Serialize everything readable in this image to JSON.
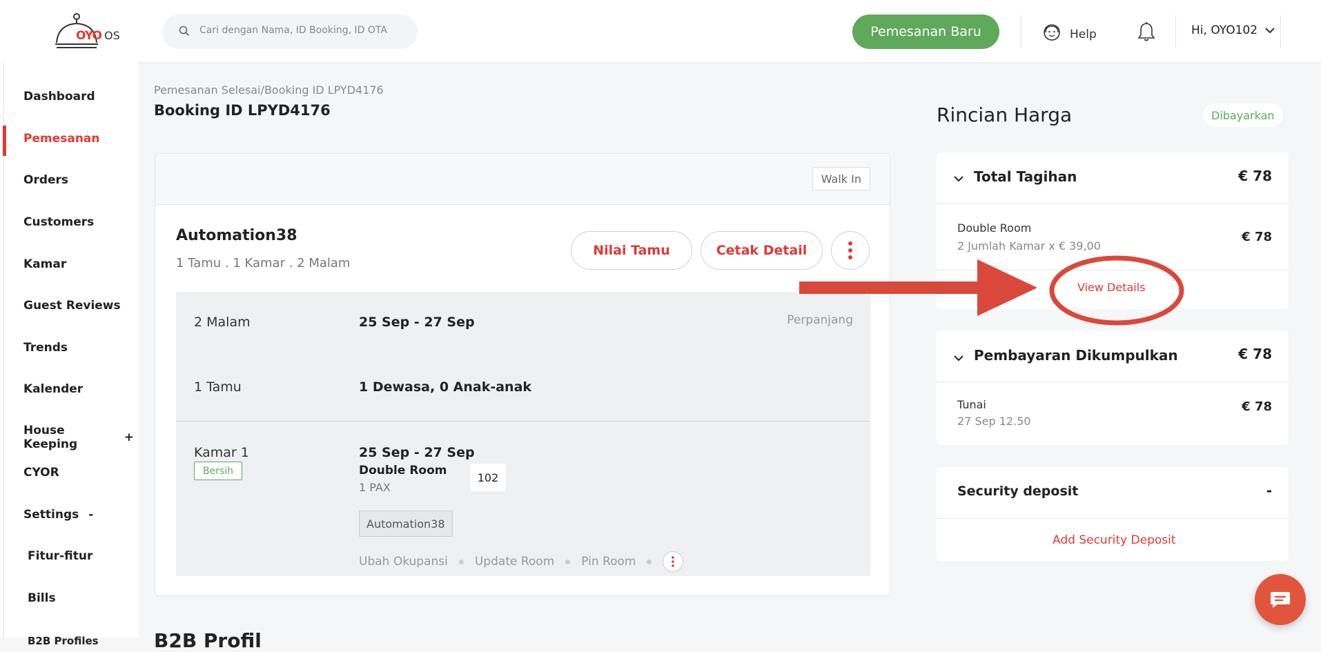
{
  "brand": {
    "logo_text": "OYO",
    "logo_suffix": "OS"
  },
  "search": {
    "placeholder": "Cari dengan Nama, ID Booking, ID OTA"
  },
  "header": {
    "new_booking": "Pemesanan Baru",
    "help": "Help",
    "user": "Hi, OYO102"
  },
  "sidebar": {
    "items": [
      {
        "label": "Dashboard"
      },
      {
        "label": "Pemesanan",
        "active": true
      },
      {
        "label": "Orders"
      },
      {
        "label": "Customers"
      },
      {
        "label": "Kamar"
      },
      {
        "label": "Guest Reviews"
      },
      {
        "label": "Trends"
      },
      {
        "label": "Kalender"
      },
      {
        "label": "House Keeping",
        "suffix": "+"
      },
      {
        "label": "CYOR"
      },
      {
        "label": "Settings",
        "suffix": "-"
      },
      {
        "label": "Fitur-fitur"
      },
      {
        "label": "Bills"
      },
      {
        "label": "B2B Profiles"
      }
    ]
  },
  "breadcrumb": {
    "parent": "Pemesanan Selesai",
    "separator": "/",
    "current": "Booking ID LPYD4176"
  },
  "page_title": "Booking ID LPYD4176",
  "booking": {
    "source_badge": "Walk In",
    "guest_name": "Automation38",
    "summary": "1 Tamu . 1 Kamar . 2 Malam",
    "rate_guest_btn": "Nilai Tamu",
    "print_btn": "Cetak Detail",
    "nights_label": "2 Malam",
    "dates": "25 Sep - 27 Sep",
    "extend": "Perpanjang",
    "guests_label": "1 Tamu",
    "guests_detail": "1 Dewasa, 0 Anak-anak",
    "room": {
      "label": "Kamar 1",
      "status": "Bersih",
      "dates": "25 Sep - 27 Sep",
      "type": "Double Room",
      "pax": "1 PAX",
      "number": "102",
      "guest_tag": "Automation38",
      "actions": [
        "Ubah Okupansi",
        "Update Room",
        "Pin Room"
      ]
    }
  },
  "price": {
    "title": "Rincian Harga",
    "status": "Dibayarkan",
    "total_label": "Total Tagihan",
    "total_amount": "€ 78",
    "item_name": "Double Room",
    "item_detail": "2 Jumlah Kamar x € 39,00",
    "item_amount": "€ 78",
    "view_details": "View Details",
    "collected_label": "Pembayaran Dikumpulkan",
    "collected_amount": "€ 78",
    "cash_label": "Tunai",
    "cash_date": "27 Sep 12.50",
    "cash_amount": "€ 78",
    "deposit_label": "Security deposit",
    "deposit_value": "-",
    "add_deposit": "Add Security Deposit"
  },
  "section_below": "B2B Profil",
  "colors": {
    "accent_red": "#e03a33",
    "green": "#5ea95a",
    "annotation_red": "#d9483b"
  }
}
